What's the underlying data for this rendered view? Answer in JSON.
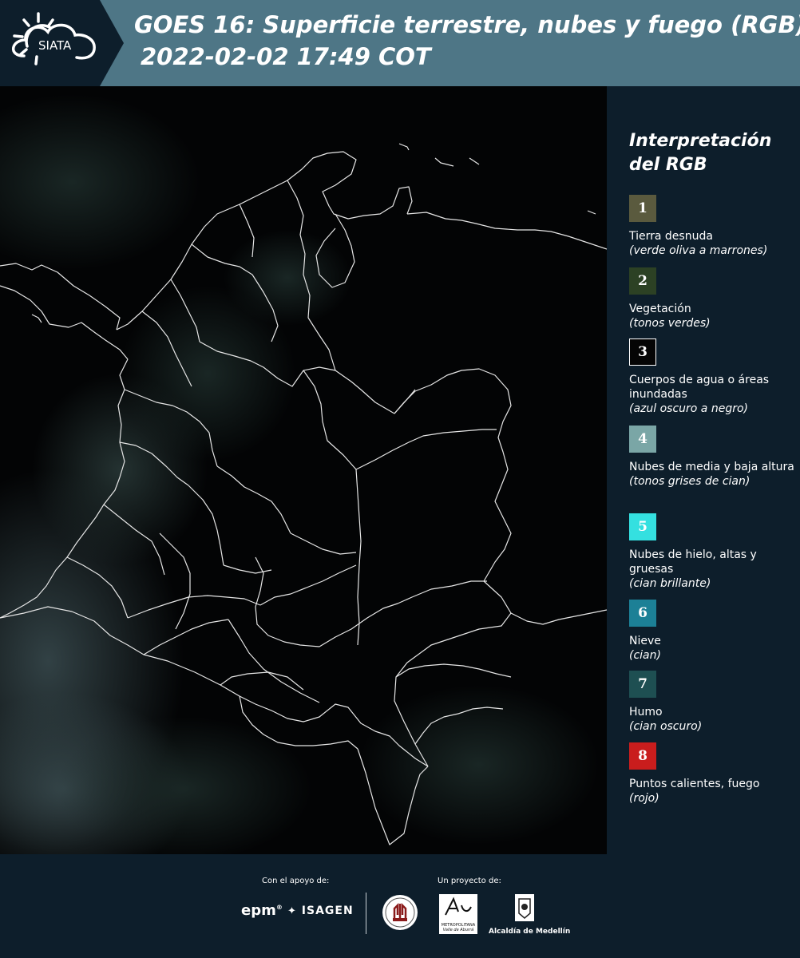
{
  "header": {
    "logo_text": "SIATA",
    "title_line1": "GOES 16: Superficie terrestre, nubes y fuego (RGB)",
    "title_line2": "2022-02-02 17:49 COT",
    "bg_color": "#4e7686"
  },
  "map": {
    "image_icon": "satellite-image-colombia-map"
  },
  "legend": {
    "title": "Interpretación del RGB",
    "items": [
      {
        "num": "1",
        "color": "#5a5a3e",
        "label": "Tierra desnuda",
        "sub": "(verde oliva a marrones)"
      },
      {
        "num": "2",
        "color": "#2c4124",
        "label": "Vegetación",
        "sub": "(tonos verdes)"
      },
      {
        "num": "3",
        "color": "#050505",
        "label": "Cuerpos de agua o áreas inundadas",
        "sub": "(azul oscuro a negro)"
      },
      {
        "num": "4",
        "color": "#7aa6a6",
        "label": "Nubes de media y baja altura",
        "sub": "(tonos grises de cian)"
      },
      {
        "num": "5",
        "color": "#34e0e0",
        "label": "Nubes de hielo, altas y gruesas",
        "sub": "(cian brillante)"
      },
      {
        "num": "6",
        "color": "#1c8096",
        "label": "Nieve",
        "sub": "(cian)"
      },
      {
        "num": "7",
        "color": "#1e4f52",
        "label": "Humo",
        "sub": "(cian oscuro)"
      },
      {
        "num": "8",
        "color": "#c91d1d",
        "label": "Puntos calientes, fuego",
        "sub": "(rojo)"
      }
    ]
  },
  "footer": {
    "support_label": "Con el apoyo de:",
    "project_label": "Un proyecto de:",
    "epm": "epm",
    "isagen": "ISAGEN",
    "metro_text": "METROPOLITANA",
    "metro_sub": "Valle de Aburrá",
    "alcaldia": "Alcaldía de Medellín"
  }
}
